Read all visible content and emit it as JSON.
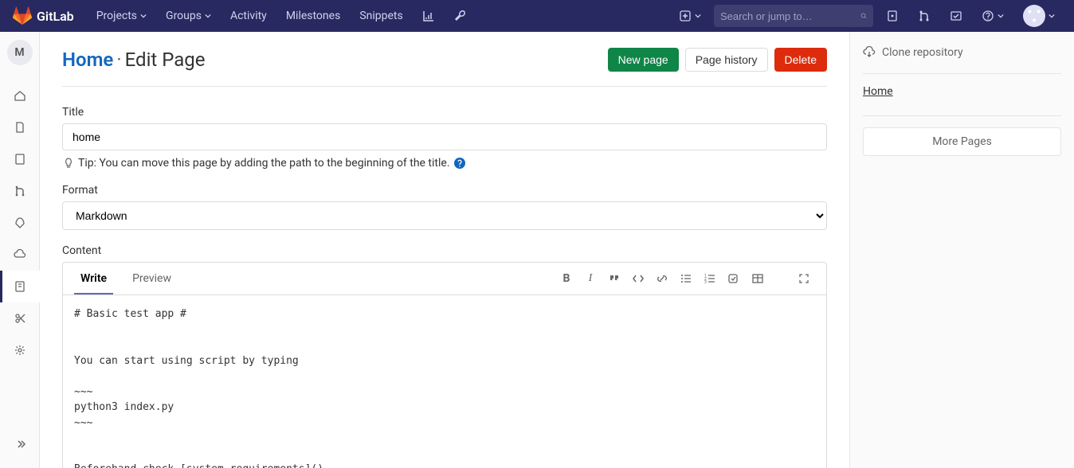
{
  "topbar": {
    "brand": "GitLab",
    "nav": {
      "projects": "Projects",
      "groups": "Groups",
      "activity": "Activity",
      "milestones": "Milestones",
      "snippets": "Snippets"
    },
    "search_placeholder": "Search or jump to…"
  },
  "sidebar": {
    "project_initial": "M"
  },
  "page": {
    "home_link": "Home",
    "subtitle": "Edit Page",
    "new_page": "New page",
    "page_history": "Page history",
    "delete": "Delete"
  },
  "form": {
    "title_label": "Title",
    "title_value": "home",
    "tip_prefix": "Tip:",
    "tip_text": "You can move this page by adding the path to the beginning of the title.",
    "format_label": "Format",
    "format_value": "Markdown",
    "content_label": "Content",
    "write_tab": "Write",
    "preview_tab": "Preview",
    "content_value": "# Basic test app #\n\n\nYou can start using script by typing\n\n~~~\npython3 index.py\n~~~\n\n\nBeforehand check [system requirements]()"
  },
  "right": {
    "clone": "Clone repository",
    "home": "Home",
    "more": "More Pages"
  }
}
